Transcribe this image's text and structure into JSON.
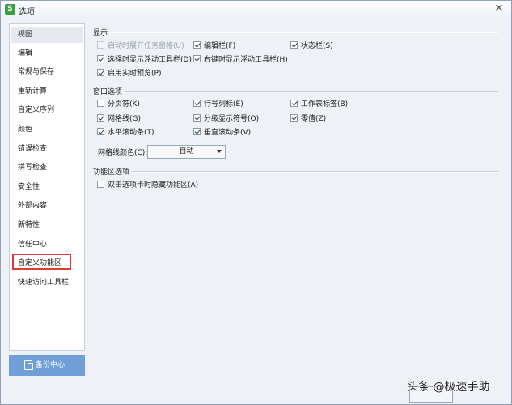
{
  "window": {
    "title": "选项",
    "app_icon_letter": "S"
  },
  "sidebar": {
    "items": [
      {
        "label": "视图",
        "active": true
      },
      {
        "label": "编辑"
      },
      {
        "label": "常规与保存"
      },
      {
        "label": "重新计算"
      },
      {
        "label": "自定义序列"
      },
      {
        "label": "颜色"
      },
      {
        "label": "错误检查"
      },
      {
        "label": "拼写检查"
      },
      {
        "label": "安全性"
      },
      {
        "label": "外部内容"
      },
      {
        "label": "新特性"
      },
      {
        "label": "信任中心"
      },
      {
        "label": "自定义功能区"
      },
      {
        "label": "快速访问工具栏"
      }
    ],
    "backup_label": "备份中心"
  },
  "display": {
    "title": "显示",
    "options": [
      {
        "label": "启动时展开任务窗格(U)",
        "checked": false,
        "disabled": true
      },
      {
        "label": "编辑栏(F)",
        "checked": true
      },
      {
        "label": "状态栏(S)",
        "checked": true
      },
      {
        "label": "选择时显示浮动工具栏(D)",
        "checked": true
      },
      {
        "label": "右键时显示浮动工具栏(H)",
        "checked": true
      },
      {
        "label": "启用实时预览(P)",
        "checked": true
      }
    ]
  },
  "window_options": {
    "title": "窗口选项",
    "options": [
      {
        "label": "分页符(K)",
        "checked": false
      },
      {
        "label": "行号列标(E)",
        "checked": true
      },
      {
        "label": "工作表标签(B)",
        "checked": true
      },
      {
        "label": "网格线(G)",
        "checked": true
      },
      {
        "label": "分级显示符号(O)",
        "checked": true
      },
      {
        "label": "零值(Z)",
        "checked": true
      },
      {
        "label": "水平滚动条(T)",
        "checked": true
      },
      {
        "label": "垂直滚动条(V)",
        "checked": true
      }
    ],
    "gridline_color_label": "网格线颜色(C):",
    "gridline_color_value": "自动"
  },
  "ribbon": {
    "title": "功能区选项",
    "options": [
      {
        "label": "双击选项卡时隐藏功能区(A)",
        "checked": false
      }
    ]
  },
  "watermark": "头条 @极速手助",
  "colors": {
    "accent": "#6f9fd6",
    "highlight": "#e53935",
    "checkmark": "#2b3a4a"
  }
}
